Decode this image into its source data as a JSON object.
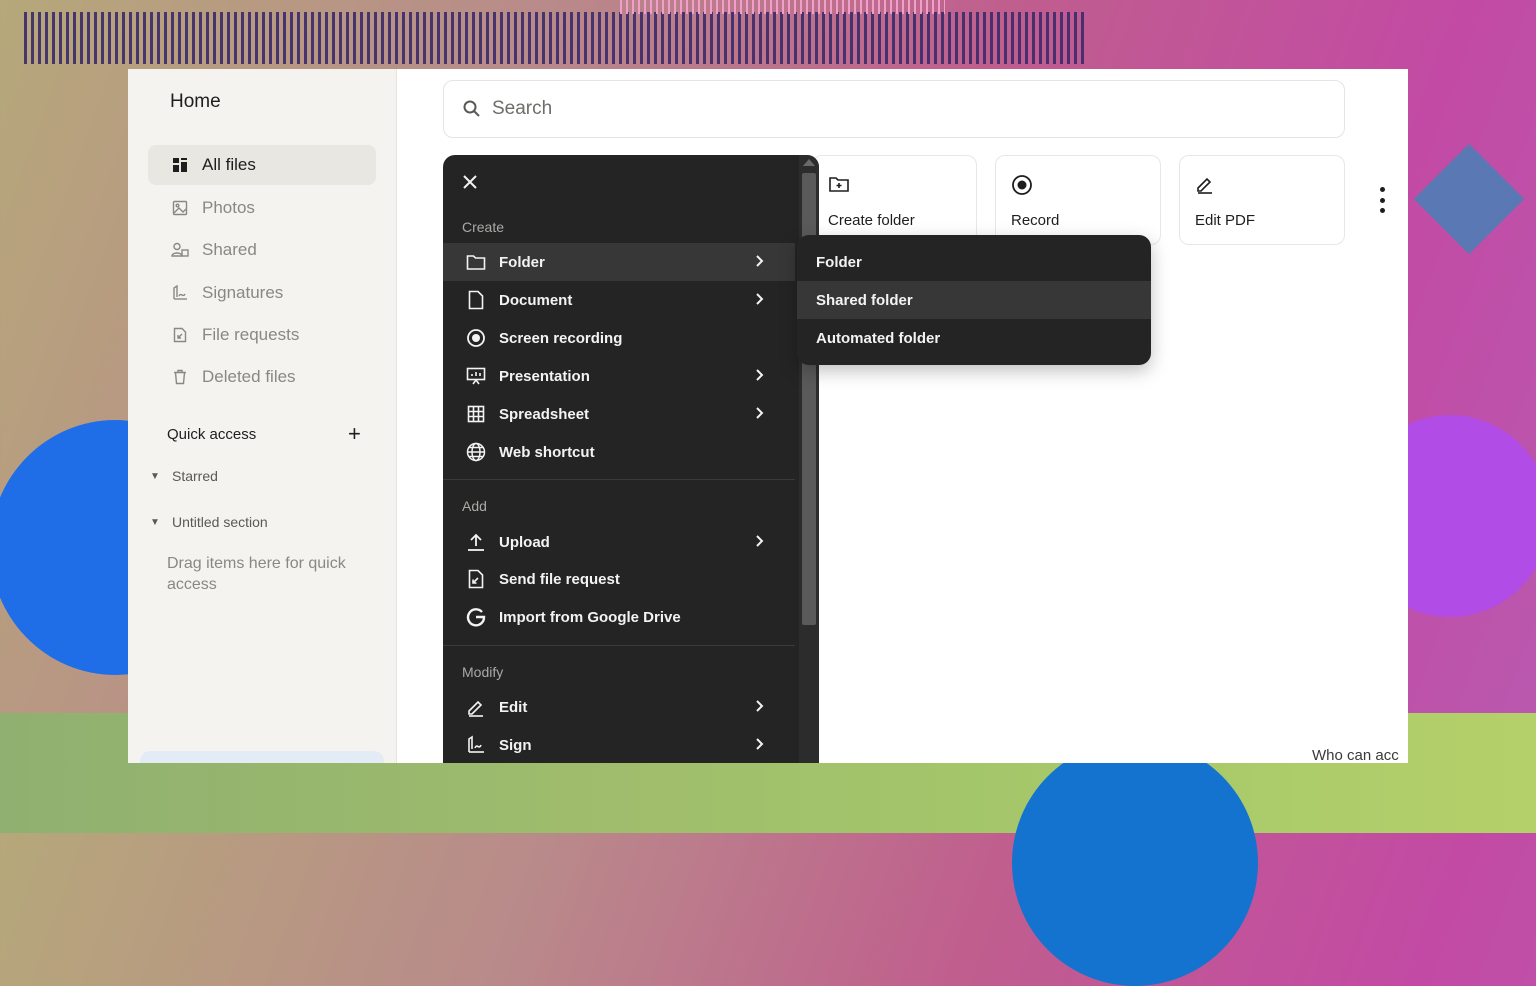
{
  "sidebar": {
    "home": "Home",
    "items": [
      {
        "label": "All files",
        "icon": "all-files-icon",
        "active": true
      },
      {
        "label": "Photos",
        "icon": "photos-icon"
      },
      {
        "label": "Shared",
        "icon": "shared-icon"
      },
      {
        "label": "Signatures",
        "icon": "signatures-icon"
      },
      {
        "label": "File requests",
        "icon": "file-requests-icon"
      },
      {
        "label": "Deleted files",
        "icon": "trash-icon"
      }
    ],
    "quick_access": {
      "title": "Quick access",
      "add": "+",
      "sections": [
        "Starred",
        "Untitled section"
      ],
      "hint": "Drag items here for quick access"
    }
  },
  "search": {
    "placeholder": "Search"
  },
  "actions": [
    {
      "label": "Create folder",
      "icon": "create-folder-icon"
    },
    {
      "label": "Record",
      "icon": "record-icon"
    },
    {
      "label": "Edit PDF",
      "icon": "edit-pdf-icon"
    }
  ],
  "footer_text": "Who can acc",
  "menu": {
    "groups": {
      "create": "Create",
      "add": "Add",
      "modify": "Modify"
    },
    "create_items": [
      {
        "label": "Folder",
        "icon": "folder-icon",
        "has_submenu": true,
        "highlighted": true
      },
      {
        "label": "Document",
        "icon": "document-icon",
        "has_submenu": true
      },
      {
        "label": "Screen recording",
        "icon": "screen-recording-icon",
        "has_submenu": false
      },
      {
        "label": "Presentation",
        "icon": "presentation-icon",
        "has_submenu": true
      },
      {
        "label": "Spreadsheet",
        "icon": "spreadsheet-icon",
        "has_submenu": true
      },
      {
        "label": "Web shortcut",
        "icon": "globe-icon",
        "has_submenu": false
      }
    ],
    "add_items": [
      {
        "label": "Upload",
        "icon": "upload-icon",
        "has_submenu": true
      },
      {
        "label": "Send file request",
        "icon": "file-request-icon",
        "has_submenu": false
      },
      {
        "label": "Import from Google Drive",
        "icon": "google-icon",
        "has_submenu": false
      }
    ],
    "modify_items": [
      {
        "label": "Edit",
        "icon": "pencil-icon",
        "has_submenu": true
      },
      {
        "label": "Sign",
        "icon": "sign-icon",
        "has_submenu": true
      }
    ]
  },
  "submenu": {
    "items": [
      {
        "label": "Folder"
      },
      {
        "label": "Shared folder",
        "highlighted": true
      },
      {
        "label": "Automated folder"
      }
    ]
  }
}
